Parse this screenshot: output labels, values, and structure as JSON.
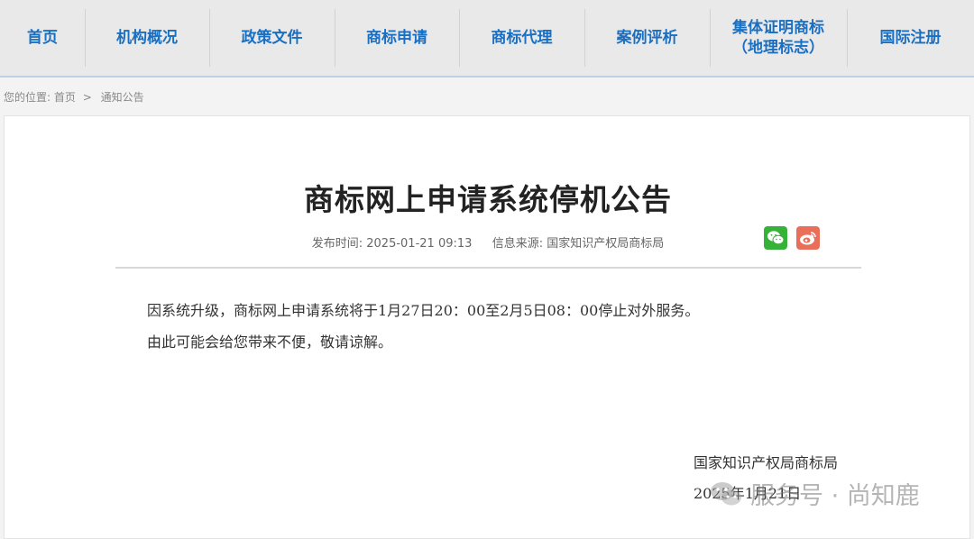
{
  "nav": {
    "items": [
      {
        "label": "首页"
      },
      {
        "label": "机构概况"
      },
      {
        "label": "政策文件"
      },
      {
        "label": "商标申请"
      },
      {
        "label": "商标代理"
      },
      {
        "label": "案例评析"
      },
      {
        "label_line1": "集体证明商标",
        "label_line2": "（地理标志）"
      },
      {
        "label": "国际注册"
      }
    ]
  },
  "breadcrumb": {
    "prefix": "您的位置:",
    "home": "首页",
    "separator": ">",
    "current": "通知公告"
  },
  "article": {
    "title": "商标网上申请系统停机公告",
    "publish_label": "发布时间:",
    "publish_time": "2025-01-21 09:13",
    "source_label": "信息来源:",
    "source": "国家知识产权局商标局",
    "paragraphs": [
      "因系统升级，商标网上申请系统将于1月27日20：00至2月5日08：00停止对外服务。",
      "由此可能会给您带来不便，敬请谅解。"
    ],
    "signature_org": "国家知识产权局商标局",
    "signature_date": "2025年1月21日"
  },
  "share": {
    "icons": [
      "wechat-icon",
      "weibo-icon"
    ],
    "colors": {
      "wechat": "#37b238",
      "weibo": "#e96f5a"
    }
  },
  "watermark": {
    "text": "服务号 · 尚知鹿"
  },
  "colors": {
    "nav_text": "#1a6fc1",
    "nav_bg": "#e9e9e9",
    "page_bg": "#f3f3f3"
  }
}
